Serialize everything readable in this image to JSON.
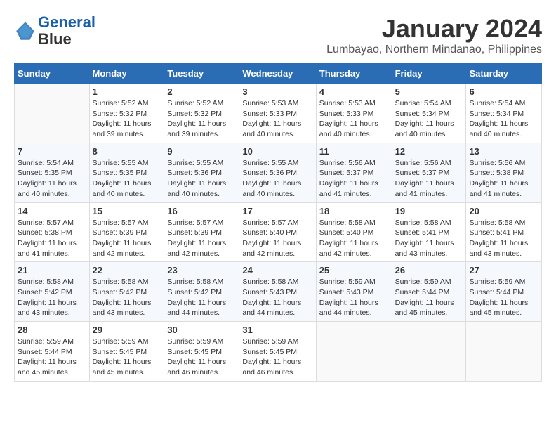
{
  "header": {
    "logo_line1": "General",
    "logo_line2": "Blue",
    "month_year": "January 2024",
    "location": "Lumbayao, Northern Mindanao, Philippines"
  },
  "weekdays": [
    "Sunday",
    "Monday",
    "Tuesday",
    "Wednesday",
    "Thursday",
    "Friday",
    "Saturday"
  ],
  "weeks": [
    [
      {
        "day": "",
        "sunrise": "",
        "sunset": "",
        "daylight": ""
      },
      {
        "day": "1",
        "sunrise": "Sunrise: 5:52 AM",
        "sunset": "Sunset: 5:32 PM",
        "daylight": "Daylight: 11 hours and 39 minutes."
      },
      {
        "day": "2",
        "sunrise": "Sunrise: 5:52 AM",
        "sunset": "Sunset: 5:32 PM",
        "daylight": "Daylight: 11 hours and 39 minutes."
      },
      {
        "day": "3",
        "sunrise": "Sunrise: 5:53 AM",
        "sunset": "Sunset: 5:33 PM",
        "daylight": "Daylight: 11 hours and 40 minutes."
      },
      {
        "day": "4",
        "sunrise": "Sunrise: 5:53 AM",
        "sunset": "Sunset: 5:33 PM",
        "daylight": "Daylight: 11 hours and 40 minutes."
      },
      {
        "day": "5",
        "sunrise": "Sunrise: 5:54 AM",
        "sunset": "Sunset: 5:34 PM",
        "daylight": "Daylight: 11 hours and 40 minutes."
      },
      {
        "day": "6",
        "sunrise": "Sunrise: 5:54 AM",
        "sunset": "Sunset: 5:34 PM",
        "daylight": "Daylight: 11 hours and 40 minutes."
      }
    ],
    [
      {
        "day": "7",
        "sunrise": "Sunrise: 5:54 AM",
        "sunset": "Sunset: 5:35 PM",
        "daylight": "Daylight: 11 hours and 40 minutes."
      },
      {
        "day": "8",
        "sunrise": "Sunrise: 5:55 AM",
        "sunset": "Sunset: 5:35 PM",
        "daylight": "Daylight: 11 hours and 40 minutes."
      },
      {
        "day": "9",
        "sunrise": "Sunrise: 5:55 AM",
        "sunset": "Sunset: 5:36 PM",
        "daylight": "Daylight: 11 hours and 40 minutes."
      },
      {
        "day": "10",
        "sunrise": "Sunrise: 5:55 AM",
        "sunset": "Sunset: 5:36 PM",
        "daylight": "Daylight: 11 hours and 40 minutes."
      },
      {
        "day": "11",
        "sunrise": "Sunrise: 5:56 AM",
        "sunset": "Sunset: 5:37 PM",
        "daylight": "Daylight: 11 hours and 41 minutes."
      },
      {
        "day": "12",
        "sunrise": "Sunrise: 5:56 AM",
        "sunset": "Sunset: 5:37 PM",
        "daylight": "Daylight: 11 hours and 41 minutes."
      },
      {
        "day": "13",
        "sunrise": "Sunrise: 5:56 AM",
        "sunset": "Sunset: 5:38 PM",
        "daylight": "Daylight: 11 hours and 41 minutes."
      }
    ],
    [
      {
        "day": "14",
        "sunrise": "Sunrise: 5:57 AM",
        "sunset": "Sunset: 5:38 PM",
        "daylight": "Daylight: 11 hours and 41 minutes."
      },
      {
        "day": "15",
        "sunrise": "Sunrise: 5:57 AM",
        "sunset": "Sunset: 5:39 PM",
        "daylight": "Daylight: 11 hours and 42 minutes."
      },
      {
        "day": "16",
        "sunrise": "Sunrise: 5:57 AM",
        "sunset": "Sunset: 5:39 PM",
        "daylight": "Daylight: 11 hours and 42 minutes."
      },
      {
        "day": "17",
        "sunrise": "Sunrise: 5:57 AM",
        "sunset": "Sunset: 5:40 PM",
        "daylight": "Daylight: 11 hours and 42 minutes."
      },
      {
        "day": "18",
        "sunrise": "Sunrise: 5:58 AM",
        "sunset": "Sunset: 5:40 PM",
        "daylight": "Daylight: 11 hours and 42 minutes."
      },
      {
        "day": "19",
        "sunrise": "Sunrise: 5:58 AM",
        "sunset": "Sunset: 5:41 PM",
        "daylight": "Daylight: 11 hours and 43 minutes."
      },
      {
        "day": "20",
        "sunrise": "Sunrise: 5:58 AM",
        "sunset": "Sunset: 5:41 PM",
        "daylight": "Daylight: 11 hours and 43 minutes."
      }
    ],
    [
      {
        "day": "21",
        "sunrise": "Sunrise: 5:58 AM",
        "sunset": "Sunset: 5:42 PM",
        "daylight": "Daylight: 11 hours and 43 minutes."
      },
      {
        "day": "22",
        "sunrise": "Sunrise: 5:58 AM",
        "sunset": "Sunset: 5:42 PM",
        "daylight": "Daylight: 11 hours and 43 minutes."
      },
      {
        "day": "23",
        "sunrise": "Sunrise: 5:58 AM",
        "sunset": "Sunset: 5:42 PM",
        "daylight": "Daylight: 11 hours and 44 minutes."
      },
      {
        "day": "24",
        "sunrise": "Sunrise: 5:58 AM",
        "sunset": "Sunset: 5:43 PM",
        "daylight": "Daylight: 11 hours and 44 minutes."
      },
      {
        "day": "25",
        "sunrise": "Sunrise: 5:59 AM",
        "sunset": "Sunset: 5:43 PM",
        "daylight": "Daylight: 11 hours and 44 minutes."
      },
      {
        "day": "26",
        "sunrise": "Sunrise: 5:59 AM",
        "sunset": "Sunset: 5:44 PM",
        "daylight": "Daylight: 11 hours and 45 minutes."
      },
      {
        "day": "27",
        "sunrise": "Sunrise: 5:59 AM",
        "sunset": "Sunset: 5:44 PM",
        "daylight": "Daylight: 11 hours and 45 minutes."
      }
    ],
    [
      {
        "day": "28",
        "sunrise": "Sunrise: 5:59 AM",
        "sunset": "Sunset: 5:44 PM",
        "daylight": "Daylight: 11 hours and 45 minutes."
      },
      {
        "day": "29",
        "sunrise": "Sunrise: 5:59 AM",
        "sunset": "Sunset: 5:45 PM",
        "daylight": "Daylight: 11 hours and 45 minutes."
      },
      {
        "day": "30",
        "sunrise": "Sunrise: 5:59 AM",
        "sunset": "Sunset: 5:45 PM",
        "daylight": "Daylight: 11 hours and 46 minutes."
      },
      {
        "day": "31",
        "sunrise": "Sunrise: 5:59 AM",
        "sunset": "Sunset: 5:45 PM",
        "daylight": "Daylight: 11 hours and 46 minutes."
      },
      {
        "day": "",
        "sunrise": "",
        "sunset": "",
        "daylight": ""
      },
      {
        "day": "",
        "sunrise": "",
        "sunset": "",
        "daylight": ""
      },
      {
        "day": "",
        "sunrise": "",
        "sunset": "",
        "daylight": ""
      }
    ]
  ]
}
